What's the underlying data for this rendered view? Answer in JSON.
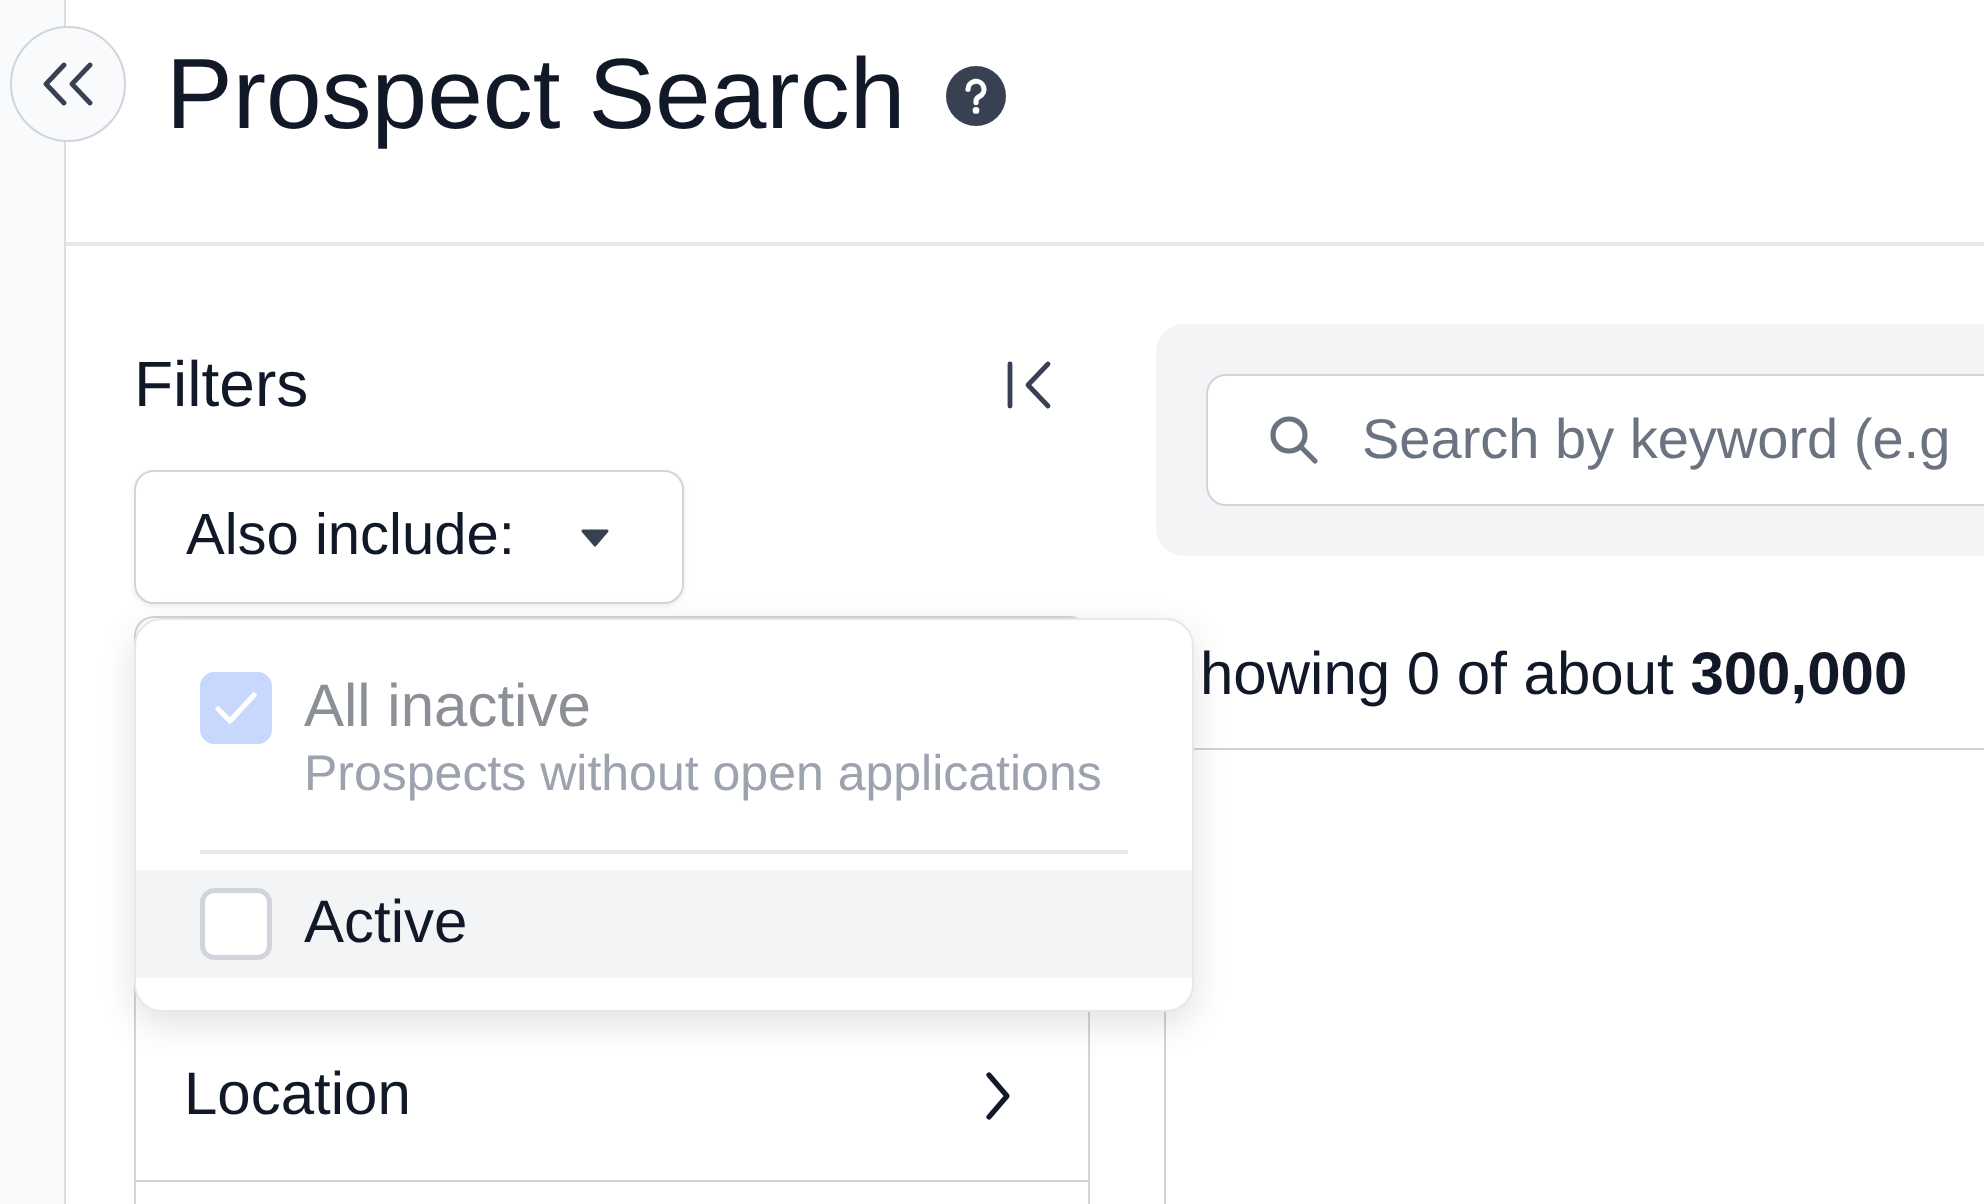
{
  "page": {
    "title": "Prospect Search"
  },
  "filters": {
    "heading": "Filters",
    "include_menu": {
      "label": "Also include:",
      "expanded": true,
      "options": [
        {
          "label": "All inactive",
          "description": "Prospects without open applications",
          "checked": true,
          "disabled": true,
          "highlighted": false
        },
        {
          "label": "Active",
          "checked": false,
          "disabled": false,
          "highlighted": true
        }
      ]
    },
    "sections": [
      {
        "label": "Location"
      }
    ]
  },
  "search": {
    "placeholder": "Search by keyword (e.g"
  },
  "results": {
    "summary": "howing 0 of about **300,000**"
  }
}
